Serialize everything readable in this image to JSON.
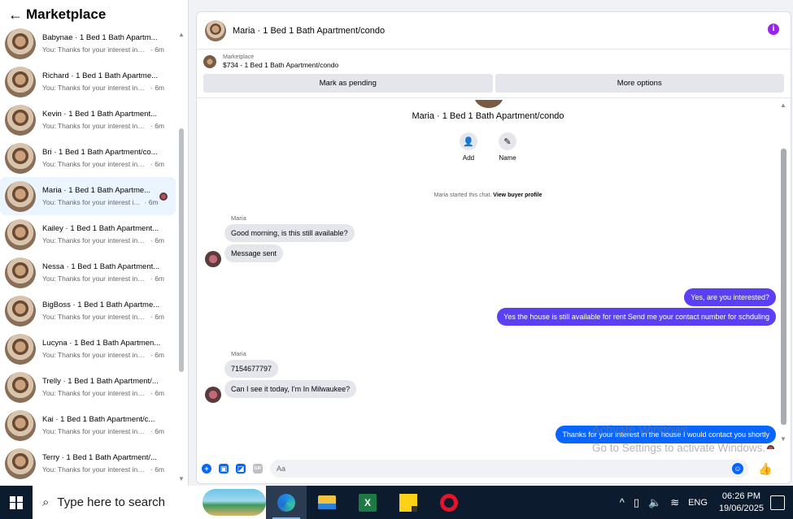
{
  "sidebar": {
    "title": "Marketplace",
    "conversations": [
      {
        "name": "Babynae · 1 Bed 1 Bath Apartm...",
        "snippet": "You: Thanks for your interest in t...",
        "time": "· 6m"
      },
      {
        "name": "Richard · 1 Bed 1 Bath Apartme...",
        "snippet": "You: Thanks for your interest in t...",
        "time": "· 6m"
      },
      {
        "name": "Kevin · 1 Bed 1 Bath Apartment...",
        "snippet": "You: Thanks for your interest in t...",
        "time": "· 6m"
      },
      {
        "name": "Bri · 1 Bed 1 Bath Apartment/co...",
        "snippet": "You: Thanks for your interest in t...",
        "time": "· 6m"
      },
      {
        "name": "Maria · 1 Bed 1 Bath Apartme...",
        "snippet": "You: Thanks for your interest i...",
        "time": "· 6m"
      },
      {
        "name": "Kailey · 1 Bed 1 Bath Apartment...",
        "snippet": "You: Thanks for your interest in t...",
        "time": "· 6m"
      },
      {
        "name": "Nessa · 1 Bed 1 Bath Apartment...",
        "snippet": "You: Thanks for your interest in t...",
        "time": "· 6m"
      },
      {
        "name": "BigBoss · 1 Bed 1 Bath Apartme...",
        "snippet": "You: Thanks for your interest in t...",
        "time": "· 6m"
      },
      {
        "name": "Lucyna · 1 Bed 1 Bath Apartmen...",
        "snippet": "You: Thanks for your interest in t...",
        "time": "· 6m"
      },
      {
        "name": "Trelly · 1 Bed 1 Bath Apartment/...",
        "snippet": "You: Thanks for your interest in t...",
        "time": "· 6m"
      },
      {
        "name": "Kai · 1 Bed 1 Bath Apartment/c...",
        "snippet": "You: Thanks for your interest in t...",
        "time": "· 6m"
      },
      {
        "name": "Terry · 1 Bed 1 Bath Apartment/...",
        "snippet": "You: Thanks for your interest in t...",
        "time": "· 6m"
      }
    ]
  },
  "chat": {
    "title": "Maria · 1 Bed 1 Bath Apartment/condo",
    "listing_label": "Marketplace",
    "listing_price": "$734 - 1 Bed 1 Bath Apartment/condo",
    "mark_pending": "Mark as pending",
    "more_options": "More options",
    "thread_title": "Maria · 1 Bed 1 Bath Apartment/condo",
    "add_label": "Add",
    "name_label": "Name",
    "system_note": "Maria started this chat.",
    "view_profile": "View buyer profile",
    "sender": "Maria",
    "messages": [
      "Good morning, is this still available?",
      "Message sent",
      "Yes, are you interested?",
      "Yes the house is still available for rent Send me your contact number for schduling",
      "7154677797",
      "Can I see it today, I'm In Milwaukee?",
      "Thanks for your interest in the house I would contact you shortly"
    ],
    "composer_placeholder": "Aa",
    "colors": {
      "accent": "#0866ff",
      "purple_bubble": "#5b3ff5",
      "info": "#9b24e8"
    }
  },
  "watermark": {
    "line1": "Activate Windows",
    "line2": "Go to Settings to activate Windows."
  },
  "taskbar": {
    "search_placeholder": "Type here to search",
    "language": "ENG",
    "time": "06:26 PM",
    "date": "19/06/2025",
    "apps": [
      "edge-icon",
      "file-explorer-icon",
      "excel-icon",
      "sticky-notes-icon",
      "opera-icon"
    ]
  }
}
